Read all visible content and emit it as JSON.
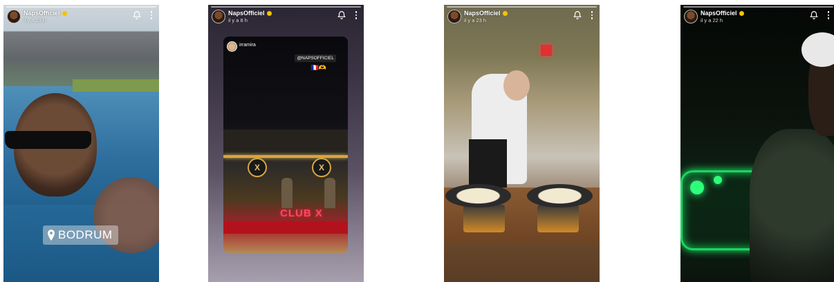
{
  "stories": [
    {
      "username": "NapsOfficiel",
      "time": "il y a 23 h",
      "location": "BODRUM"
    },
    {
      "username": "NapsOfficiel",
      "time": "il y a 8 h",
      "reshare": {
        "username": "irramira",
        "tag": "@NAPSOFFICIEL",
        "emoji": "🇫🇷🫶",
        "logo_letter": "X",
        "sign": "CLUB X"
      }
    },
    {
      "username": "NapsOfficiel",
      "time": "il y a 23 h"
    },
    {
      "username": "NapsOfficiel",
      "time": "il y a 22 h"
    }
  ],
  "icons": {
    "bell": "bell-icon",
    "more": "more-vertical-icon",
    "location": "location-pin-icon",
    "verified": "verified-badge-icon"
  },
  "colors": {
    "verified": "#f3c400",
    "neon_green": "#20ff70",
    "club_sign": "#ff4760"
  }
}
